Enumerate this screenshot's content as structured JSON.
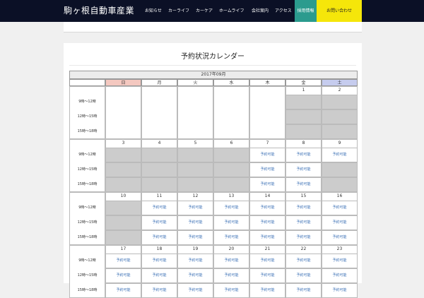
{
  "header": {
    "logo": "駒ヶ根自動車産業",
    "nav": [
      "お知らせ",
      "カーライフ",
      "カーケア",
      "ホームライフ",
      "会社案内",
      "アクセス"
    ],
    "recruit": "採用情報",
    "contact": "お問い合わせ"
  },
  "main": {
    "title": "予約状況カレンダー"
  },
  "calendar": {
    "month": "2017年09月",
    "weekdays": [
      "日",
      "月",
      "火",
      "水",
      "木",
      "金",
      "土"
    ],
    "slots": [
      "9時〜12時",
      "12時〜15時",
      "15時〜18時"
    ],
    "weeks": [
      {
        "days": [
          "",
          "",
          "",
          "",
          "",
          "1",
          "2"
        ],
        "open": [
          [
            0,
            0,
            0
          ],
          [
            0,
            0,
            0
          ],
          [
            0,
            0,
            0
          ],
          [
            0,
            0,
            0
          ],
          [
            0,
            0,
            0
          ],
          [
            -1,
            -1,
            -1
          ],
          [
            -1,
            -1,
            -1
          ]
        ]
      },
      {
        "days": [
          "3",
          "4",
          "5",
          "6",
          "7",
          "8",
          "9"
        ],
        "open": [
          [
            -1,
            -1,
            -1
          ],
          [
            -1,
            -1,
            -1
          ],
          [
            -1,
            -1,
            -1
          ],
          [
            -1,
            -1,
            -1
          ],
          [
            1,
            1,
            1
          ],
          [
            1,
            1,
            1
          ],
          [
            1,
            -1,
            -1
          ]
        ]
      },
      {
        "days": [
          "10",
          "11",
          "12",
          "13",
          "14",
          "15",
          "16"
        ],
        "open": [
          [
            -1,
            -1,
            -1
          ],
          [
            1,
            1,
            1
          ],
          [
            1,
            1,
            1
          ],
          [
            1,
            1,
            1
          ],
          [
            1,
            1,
            1
          ],
          [
            1,
            1,
            1
          ],
          [
            1,
            1,
            1
          ]
        ]
      },
      {
        "days": [
          "17",
          "18",
          "19",
          "20",
          "21",
          "22",
          "23"
        ],
        "open": [
          [
            1,
            1,
            1
          ],
          [
            1,
            1,
            1
          ],
          [
            1,
            1,
            1
          ],
          [
            1,
            1,
            1
          ],
          [
            1,
            1,
            1
          ],
          [
            1,
            1,
            1
          ],
          [
            1,
            1,
            1
          ]
        ]
      }
    ],
    "status_label": "予約可能"
  },
  "colors": {
    "header_bg": "#0b1026",
    "recruit_bg": "#2b9b8e",
    "contact_bg": "#f5e60a",
    "sunday": "#f4c8c0",
    "saturday": "#c6ccee",
    "closed": "#cccccc",
    "link": "#3a6fb5"
  }
}
